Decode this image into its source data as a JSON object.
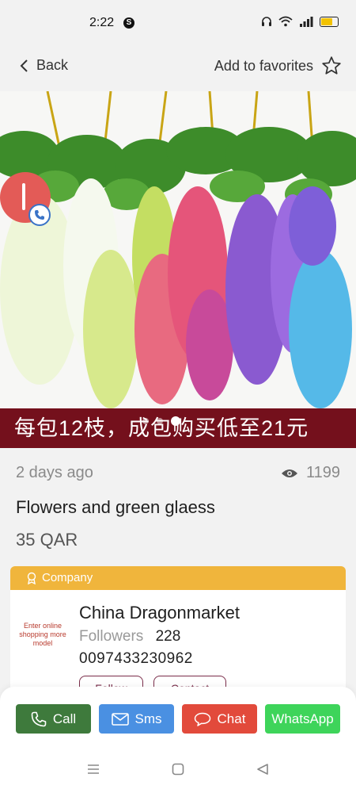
{
  "status_bar": {
    "time": "2:22",
    "app_badge": "S"
  },
  "header": {
    "back_label": "Back",
    "favorites_label": "Add to favorites"
  },
  "hero": {
    "banner_text": "每包12枝，成包购买低至21元",
    "slide_count": 3,
    "active_slide": 2
  },
  "listing": {
    "posted": "2 days ago",
    "views": "1199",
    "title": "Flowers and green glaess",
    "price": "35 QAR"
  },
  "company": {
    "section_label": "Company",
    "logo_text": "Enter online shopping more model",
    "name": "China Dragonmarket",
    "followers_label": "Followers",
    "followers_count": "228",
    "phone": "0097433230962",
    "follow_label": "Follow",
    "contact_label": "Contact"
  },
  "actions": {
    "call": "Call",
    "sms": "Sms",
    "chat": "Chat",
    "whatsapp": "WhatsApp"
  },
  "colors": {
    "call": "#3e7a3c",
    "sms": "#4a90e2",
    "chat": "#e24a3b",
    "whatsapp": "#3ed45a",
    "company_header": "#f0b53c",
    "banner": "#74101c"
  }
}
